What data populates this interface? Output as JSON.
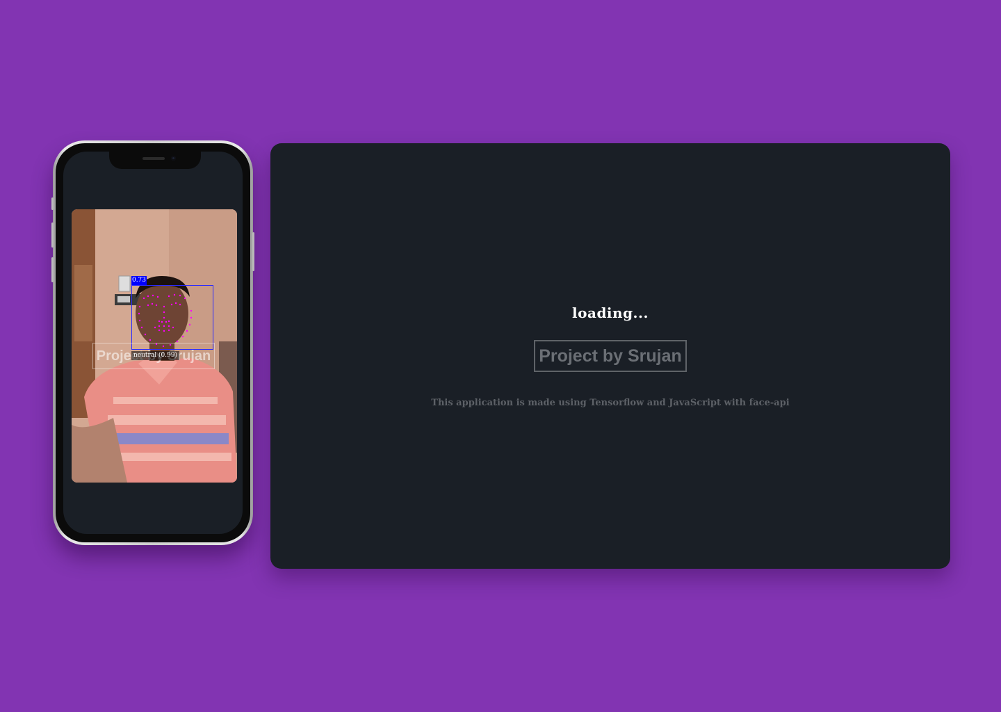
{
  "phone": {
    "detection_score": "0.73",
    "expression_label": "neutral (0.99)",
    "watermark_text": "Project by Srujan"
  },
  "panel": {
    "status_text": "loading...",
    "credit_text": "Project by Srujan",
    "description": "This application is made using Tensorflow and JavaScript with face-api"
  },
  "colors": {
    "background": "#8234b2",
    "panel": "#1a1f26",
    "face_box": "#2a2aff",
    "landmarks": "#ff00ff"
  }
}
